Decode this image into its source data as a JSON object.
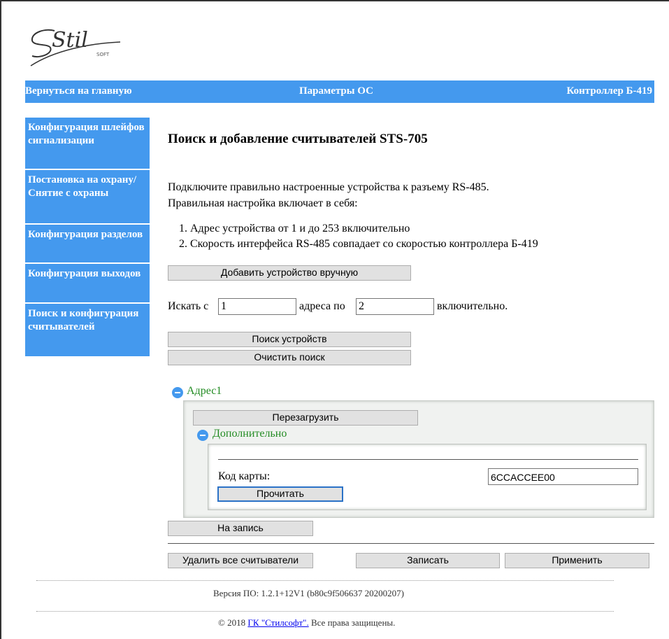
{
  "logo": {
    "icon": "stilsoft-logo",
    "brand_text": "Stil",
    "sub_text": "SOFT"
  },
  "colors": {
    "accent": "#4499ee",
    "group_title": "#228b22",
    "link": "#0000ee"
  },
  "topbar": {
    "home_link": "Вернуться на главную",
    "section_title": "Параметры ОС",
    "device_name": "Контроллер Б-419"
  },
  "sidebar": {
    "items": [
      {
        "label": "Конфигурация шлейфов сигнализации"
      },
      {
        "label": "Постановка на охрану/Снятие с охраны"
      },
      {
        "label": "Конфигурация разделов"
      },
      {
        "label": "Конфигурация выходов"
      },
      {
        "label": "Поиск и конфигурация считывателей"
      }
    ]
  },
  "main": {
    "title": "Поиск и добавление считывателей STS-705",
    "intro_line1": "Подключите правильно настроенные устройства к разъему RS-485.",
    "intro_line2": "Правильная настройка включает в себя:",
    "requirements": [
      "Адрес устройства от 1 и до 253 включительно",
      "Скорость интерфейса RS-485 совпадает со скоростью контроллера Б-419"
    ],
    "add_manual_button": "Добавить устройство вручную",
    "search_from_label": "Искать с",
    "search_from_value": "1",
    "search_to_label": "адреса по",
    "search_to_value": "2",
    "search_suffix": "включительно.",
    "search_button": "Поиск устройств",
    "clear_button": "Очистить поиск",
    "device": {
      "title": "Адрес1",
      "reboot_button": "Перезагрузить",
      "extra_title": "Дополнительно",
      "card_code_label": "Код карты:",
      "card_code_value": "6CCACCEE00",
      "read_button": "Прочитать"
    },
    "write_entry_button": "На запись",
    "delete_all_button": "Удалить все считыватели",
    "save_button": "Записать",
    "apply_button": "Применить"
  },
  "footer": {
    "version": "Версия ПО: 1.2.1+12V1 (b80c9f506637 20200207)",
    "copyright_prefix": "© 2018",
    "company_link": "ГК \"Стилсофт\".",
    "rights": "Все права защищены."
  }
}
